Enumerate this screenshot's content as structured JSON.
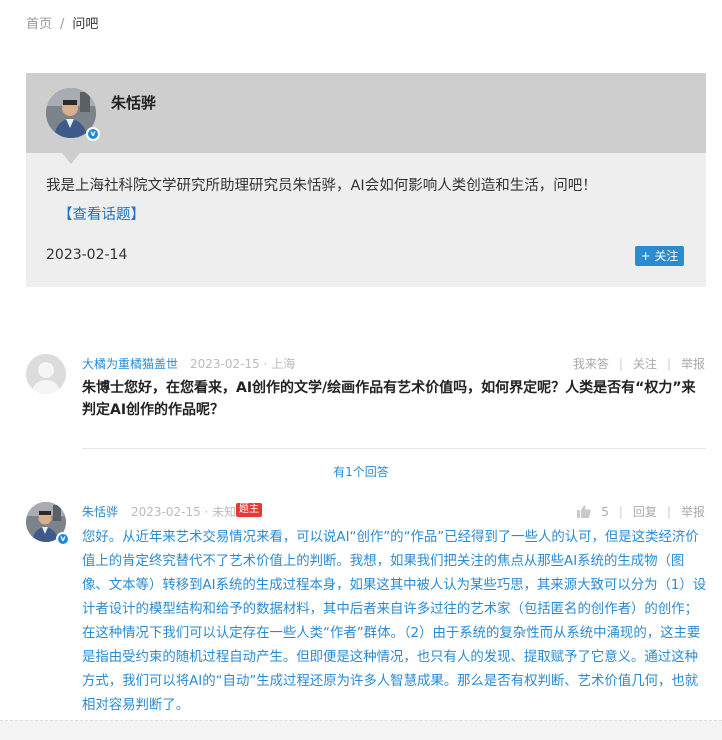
{
  "breadcrumb": {
    "home": "首页",
    "sep": "/",
    "current": "问吧"
  },
  "host": {
    "name": "朱恬骅",
    "intro": "我是上海社科院文学研究所助理研究员朱恬骅，AI会如何影响人类创造和生活，问吧！",
    "topic_link": "【查看话题】",
    "date": "2023-02-14",
    "follow_label": "+ 关注",
    "verified_mark": "v"
  },
  "question": {
    "user": "大橘为重橘猫盖世",
    "meta": "2023-02-15 · 上海",
    "actions": [
      "我来答",
      "关注",
      "举报"
    ],
    "text": "朱博士您好，在您看来，AI创作的文学/绘画作品有艺术价值吗，如何界定呢？人类是否有“权力”来判定AI创作的作品呢？"
  },
  "answer_count": "有1个回答",
  "answer": {
    "user": "朱恬骅",
    "meta": "2023-02-15 · 未知",
    "tag": "题主",
    "likes": "5",
    "actions": [
      "回复",
      "举报"
    ],
    "verified_mark": "v",
    "text": "您好。从近年来艺术交易情况来看，可以说AI“创作”的“作品”已经得到了一些人的认可，但是这类经济价值上的肯定终究替代不了艺术价值上的判断。我想，如果我们把关注的焦点从那些AI系统的生成物（图像、文本等）转移到AI系统的生成过程本身，如果这其中被人认为某些巧思，其来源大致可以分为（1）设计者设计的模型结构和给予的数据材料，其中后者来自许多过往的艺术家（包括匿名的创作者）的创作；在这种情况下我们可以认定存在一些人类“作者”群体。（2）由于系统的复杂性而从系统中涌现的，这主要是指由受约束的随机过程自动产生。但即便是这种情况，也只有人的发现、提取赋予了它意义。通过这种方式，我们可以将AI的“自动”生成过程还原为许多人智慧成果。那么是否有权判断、艺术价值几何，也就相对容易判断了。"
  },
  "colors": {
    "link": "#2a8bd3",
    "card_bg": "#eeeeee",
    "card_head_bg": "#cecece",
    "tag_red": "#e53935"
  }
}
